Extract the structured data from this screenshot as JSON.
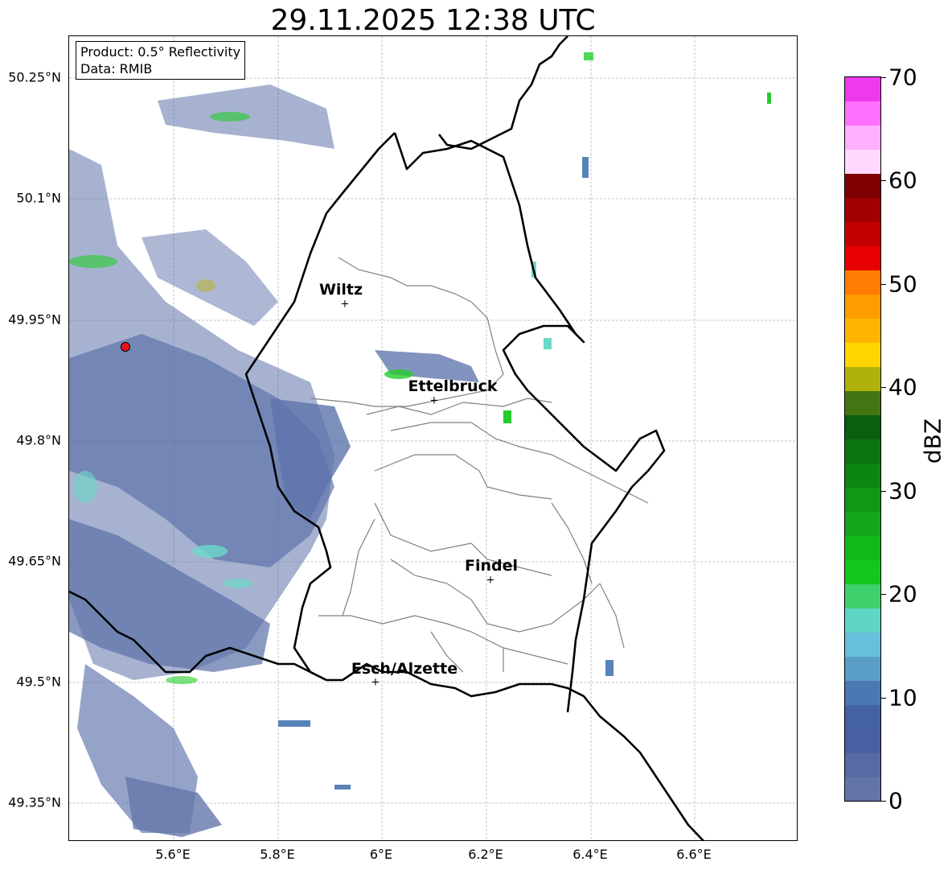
{
  "title": "29.11.2025 12:38 UTC",
  "info": {
    "product": "Product: 0.5° Reflectivity",
    "data": "Data: RMIB"
  },
  "lat_ticks": [
    "50.25°N",
    "50.1°N",
    "49.95°N",
    "49.8°N",
    "49.65°N",
    "49.5°N",
    "49.35°N"
  ],
  "lon_ticks": [
    "5.6°E",
    "5.8°E",
    "6°E",
    "6.2°E",
    "6.4°E",
    "6.6°E"
  ],
  "cities": [
    {
      "name": "Wiltz",
      "marker": "+"
    },
    {
      "name": "Ettelbruck",
      "marker": "+"
    },
    {
      "name": "Findel",
      "marker": "+"
    },
    {
      "name": "Esch/Alzette",
      "marker": "+"
    }
  ],
  "radar_site_color": "#e8141c",
  "colorbar": {
    "label": "dBZ",
    "ticks": [
      "0",
      "10",
      "20",
      "30",
      "40",
      "50",
      "60",
      "70"
    ],
    "colors": [
      "#6374a8",
      "#566aa3",
      "#4a5fa1",
      "#4262a5",
      "#4a78b3",
      "#5a9ec8",
      "#66c0db",
      "#5fd6c5",
      "#3ed06c",
      "#13c81c",
      "#12b81a",
      "#12a618",
      "#109715",
      "#0d8512",
      "#0b7410",
      "#0a5e0d",
      "#437512",
      "#afb20a",
      "#ffd500",
      "#ffb500",
      "#ff9c00",
      "#ff7d00",
      "#e60000",
      "#c40000",
      "#a10000",
      "#7e0000",
      "#ffd8ff",
      "#ffb0ff",
      "#ff70ff",
      "#ee3aee"
    ]
  }
}
